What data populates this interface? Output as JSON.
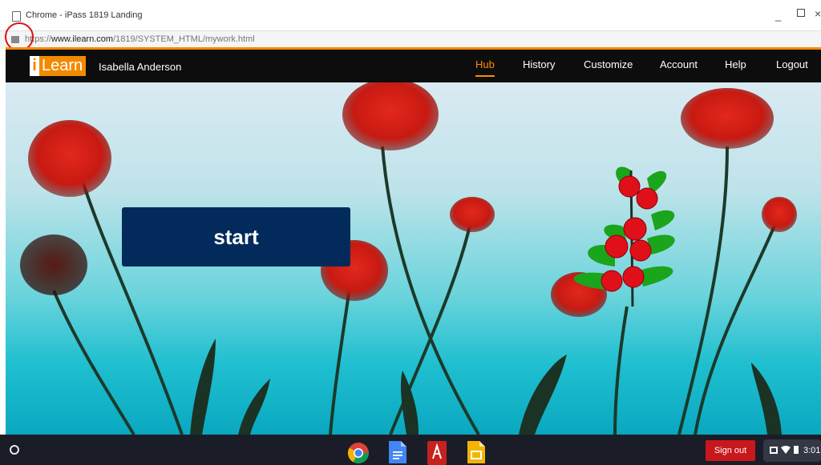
{
  "window": {
    "title": "Chrome - iPass 1819 Landing"
  },
  "address_bar": {
    "scheme_prefix": "https://",
    "host": "www.ilearn.com",
    "path": "/1819/SYSTEM_HTML/mywork.html"
  },
  "app_header": {
    "logo_i": "i",
    "logo_text": "Learn",
    "user_name": "Isabella Anderson",
    "nav": [
      {
        "label": "Hub",
        "active": true
      },
      {
        "label": "History",
        "active": false
      },
      {
        "label": "Customize",
        "active": false
      },
      {
        "label": "Account",
        "active": false
      },
      {
        "label": "Help",
        "active": false
      },
      {
        "label": "Logout",
        "active": false
      }
    ]
  },
  "hero": {
    "start_label": "start"
  },
  "taskbar": {
    "apps": [
      "chrome-icon",
      "docs-icon",
      "book-reader-icon",
      "slides-icon"
    ],
    "sign_out_label": "Sign out",
    "time": "3:01"
  },
  "colors": {
    "accent": "#ff8a00",
    "start_button": "#022b5b",
    "sign_out": "#c8171d"
  }
}
